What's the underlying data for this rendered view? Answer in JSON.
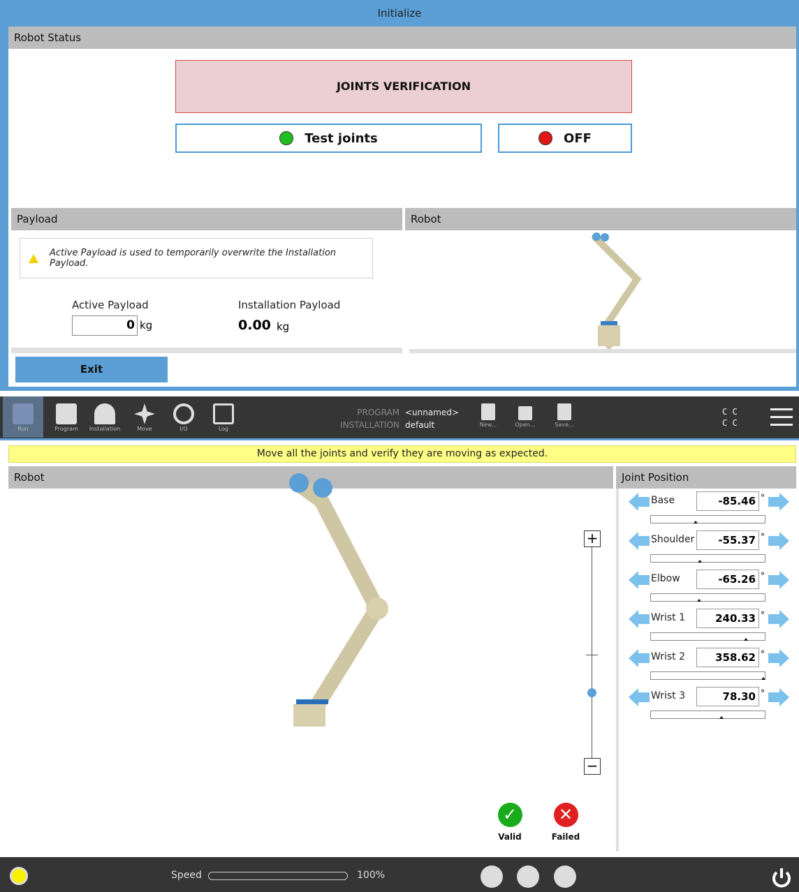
{
  "init": {
    "title": "Initialize",
    "robot_status": "Robot Status",
    "joints_verification": "JOINTS VERIFICATION",
    "test_joints": "Test joints",
    "off": "OFF",
    "payload_header": "Payload",
    "robot_header": "Robot",
    "warning": "Active Payload is used to temporarily overwrite the Installation Payload.",
    "active_payload_label": "Active Payload",
    "active_payload_value": "0",
    "installation_payload_label": "Installation Payload",
    "installation_payload_value": "0.00",
    "unit": "kg",
    "exit": "Exit"
  },
  "nav": {
    "items": [
      {
        "label": "Run",
        "icon": "ur-logo-icon"
      },
      {
        "label": "Program",
        "icon": "program-icon"
      },
      {
        "label": "Installation",
        "icon": "installation-icon"
      },
      {
        "label": "Move",
        "icon": "move-icon"
      },
      {
        "label": "I/O",
        "icon": "io-icon"
      },
      {
        "label": "Log",
        "icon": "log-icon"
      }
    ],
    "program_label": "PROGRAM",
    "installation_label": "INSTALLATION",
    "program_value": "<unnamed>",
    "installation_value": "default",
    "new": "New...",
    "open": "Open...",
    "save": "Save...",
    "cc1": "C C",
    "cc2": "C C"
  },
  "hint": "Move all the joints and verify they are moving as expected.",
  "robot_header": "Robot",
  "joint_header": "Joint Position",
  "joints": [
    {
      "name": "Base",
      "value": "-85.46",
      "pos": 0.38
    },
    {
      "name": "Shoulder",
      "value": "-55.37",
      "pos": 0.42
    },
    {
      "name": "Elbow",
      "value": "-65.26",
      "pos": 0.41
    },
    {
      "name": "Wrist 1",
      "value": "240.33",
      "pos": 0.83
    },
    {
      "name": "Wrist 2",
      "value": "358.62",
      "pos": 0.99
    },
    {
      "name": "Wrist 3",
      "value": "78.30",
      "pos": 0.61
    }
  ],
  "deg": "°",
  "valid": "Valid",
  "failed": "Failed",
  "speed_label": "Speed",
  "speed_value": "100%",
  "colors": {
    "accent": "#5b9fd6",
    "valid": "#1aab1a",
    "failed": "#e02020",
    "test_dot": "#1fbf1f",
    "off_dot": "#e01818"
  }
}
